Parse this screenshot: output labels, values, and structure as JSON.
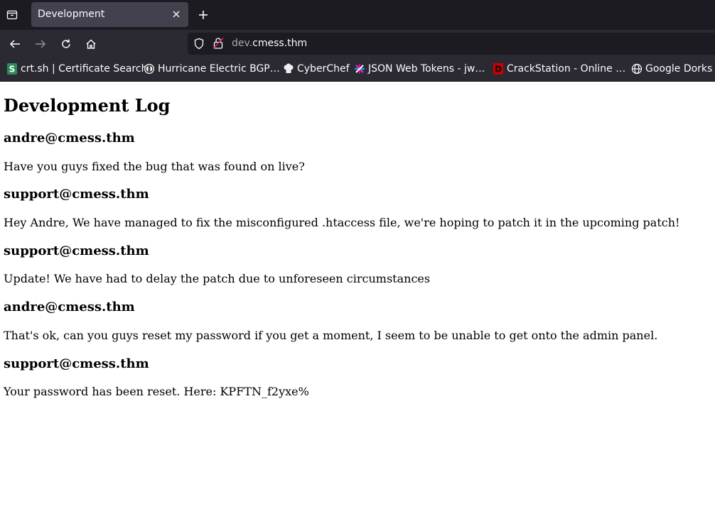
{
  "browser": {
    "tab_title": "Development",
    "url_subdomain": "dev.",
    "url_domain": "cmess.thm"
  },
  "bookmarks": [
    {
      "label": "crt.sh | Certificate Search",
      "icon": "crtsh-icon"
    },
    {
      "label": "Hurricane Electric BGP…",
      "icon": "hurricane-electric-icon"
    },
    {
      "label": "CyberChef",
      "icon": "cyberchef-icon"
    },
    {
      "label": "JSON Web Tokens - jw…",
      "icon": "jwt-icon"
    },
    {
      "label": "CrackStation - Online …",
      "icon": "crackstation-icon"
    },
    {
      "label": "Google Dorks fo",
      "icon": "globe-icon"
    }
  ],
  "page": {
    "title": "Development Log",
    "entries": [
      {
        "author": "andre@cmess.thm",
        "message": "Have you guys fixed the bug that was found on live?"
      },
      {
        "author": "support@cmess.thm",
        "message": "Hey Andre, We have managed to fix the misconfigured .htaccess file, we're hoping to patch it in the upcoming patch!"
      },
      {
        "author": "support@cmess.thm",
        "message": "Update! We have had to delay the patch due to unforeseen circumstances"
      },
      {
        "author": "andre@cmess.thm",
        "message": "That's ok, can you guys reset my password if you get a moment, I seem to be unable to get onto the admin panel."
      },
      {
        "author": "support@cmess.thm",
        "message": "Your password has been reset. Here: KPFTN_f2yxe%"
      }
    ]
  }
}
